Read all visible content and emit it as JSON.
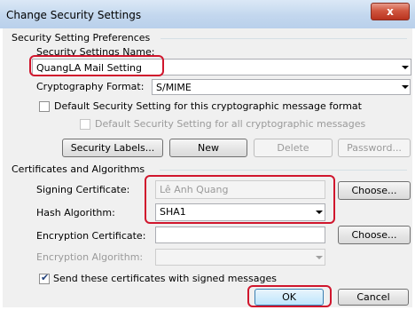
{
  "window": {
    "title": "Change Security Settings",
    "close_label": "x"
  },
  "preferences": {
    "group_title": "Security Setting Preferences",
    "name_label": "Security Settings Name:",
    "name_value": "QuangLA Mail Setting",
    "crypto_label": "Cryptography Format:",
    "crypto_value": "S/MIME",
    "default_format_label": "Default Security Setting for this cryptographic message format",
    "default_all_label": "Default Security Setting for all cryptographic messages",
    "default_format_checked": false,
    "default_all_checked": false
  },
  "preference_buttons": {
    "security_labels": "Security Labels...",
    "new": "New",
    "delete": "Delete",
    "password": "Password..."
  },
  "certificates": {
    "group_title": "Certificates and Algorithms",
    "signing_label": "Signing Certificate:",
    "signing_value": "Lê Anh Quang",
    "signing_choose": "Choose...",
    "hash_label": "Hash Algorithm:",
    "hash_value": "SHA1",
    "encryption_label": "Encryption Certificate:",
    "encryption_value": "",
    "encryption_choose": "Choose...",
    "enc_algorithm_label": "Encryption Algorithm:",
    "enc_algorithm_value": "",
    "send_certs_label": "Send these certificates with signed messages",
    "send_certs_checked": true
  },
  "footer": {
    "ok": "OK",
    "cancel": "Cancel"
  },
  "colors": {
    "highlight": "#d0162d",
    "titlebar": "#c3d7ee",
    "dialog_bg": "#f0f0f0"
  },
  "icons": {
    "dropdown": "chevron-down-icon",
    "check": "checkmark-icon",
    "close": "close-icon"
  }
}
